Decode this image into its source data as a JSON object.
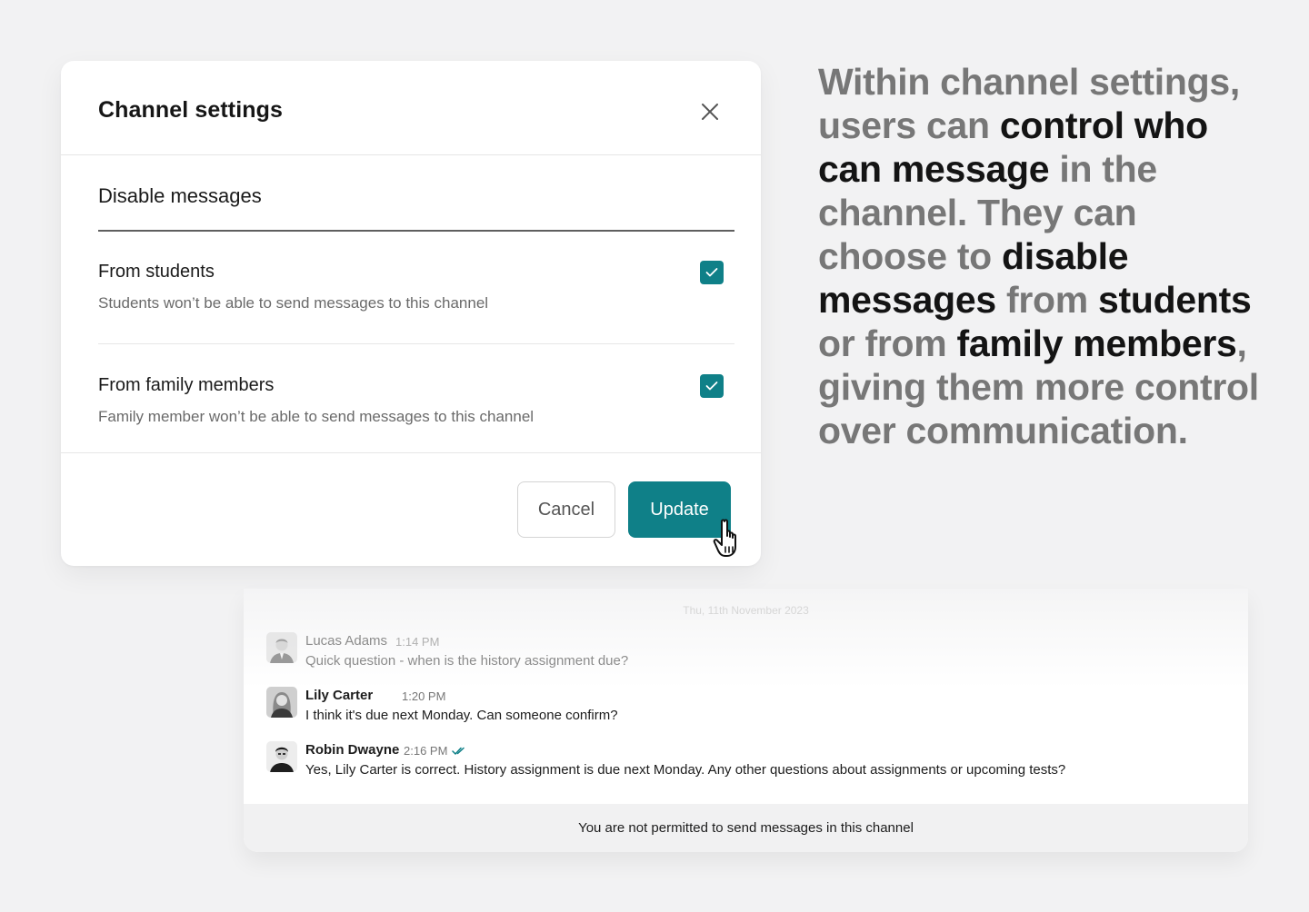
{
  "colors": {
    "accent": "#0f8088",
    "page_bg": "#f2f2f3"
  },
  "modal": {
    "title": "Channel settings",
    "close_icon": "close-icon",
    "section_title": "Disable messages",
    "options": [
      {
        "label": "From students",
        "description": "Students won’t be able to send messages to this channel",
        "checked": true
      },
      {
        "label": "From family members",
        "description": "Family member won’t be able to send messages to this channel",
        "checked": true
      }
    ],
    "cancel_label": "Cancel",
    "update_label": "Update"
  },
  "blurb": {
    "segments": [
      {
        "text": "Within channel settings, users can ",
        "emphasis": false
      },
      {
        "text": "control who can message",
        "emphasis": true
      },
      {
        "text": " in the channel. They can choose to ",
        "emphasis": false
      },
      {
        "text": "disable messages",
        "emphasis": true
      },
      {
        "text": " from ",
        "emphasis": false
      },
      {
        "text": "students",
        "emphasis": true
      },
      {
        "text": " or from ",
        "emphasis": false
      },
      {
        "text": "family members",
        "emphasis": true
      },
      {
        "text": ", giving them more control over communication.",
        "emphasis": false
      }
    ]
  },
  "chat": {
    "date": "Thu, 11th November 2023",
    "messages": [
      {
        "name": "Lucas Adams",
        "time": "1:14 PM",
        "text": "Quick question - when is the history assignment due?"
      },
      {
        "name": "Lily Carter",
        "time": "1:20 PM",
        "text": "I think it's due next Monday. Can someone confirm?"
      },
      {
        "name": "Robin Dwayne",
        "time": "2:16 PM",
        "text": "Yes, Lily Carter is correct. History assignment is due next Monday. Any other questions about assignments or upcoming tests?"
      }
    ],
    "footer_notice": "You are not permitted to send messages in this channel"
  }
}
